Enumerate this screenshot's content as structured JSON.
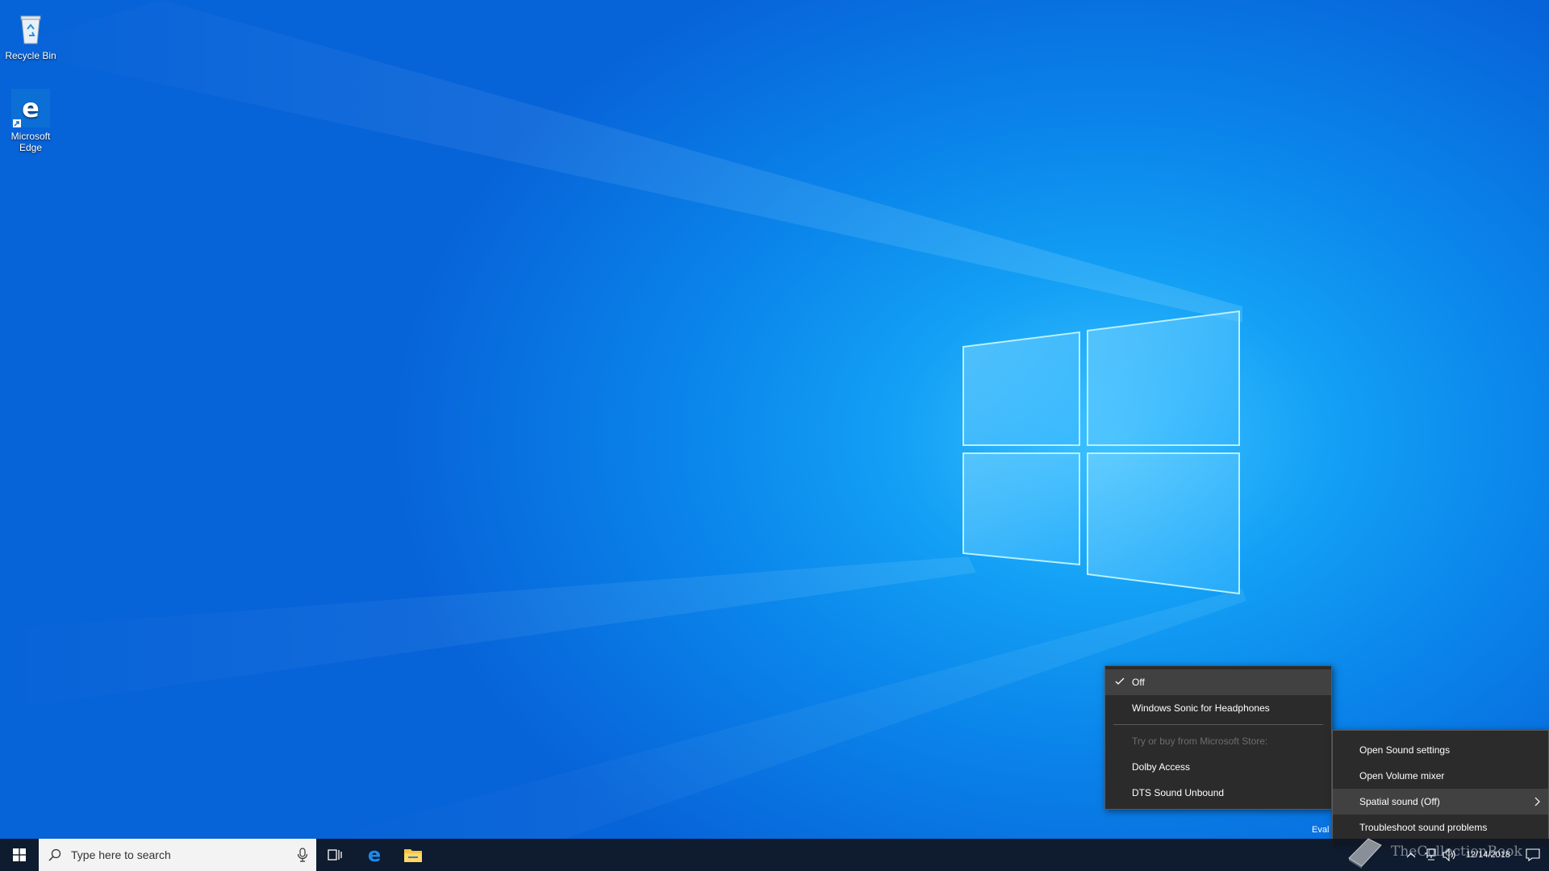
{
  "desktop": {
    "icons": [
      {
        "label": "Recycle Bin"
      },
      {
        "label": "Microsoft Edge"
      }
    ]
  },
  "spatial_menu": {
    "items": [
      {
        "label": "Off",
        "checked": true
      },
      {
        "label": "Windows Sonic for Headphones"
      }
    ],
    "store_header": "Try or buy from Microsoft Store:",
    "store_items": [
      {
        "label": "Dolby Access"
      },
      {
        "label": "DTS Sound Unbound"
      }
    ]
  },
  "sound_menu": {
    "items": [
      {
        "label": "Open Sound settings"
      },
      {
        "label": "Open Volume mixer"
      },
      {
        "label": "Spatial sound (Off)"
      },
      {
        "label": "Troubleshoot sound problems"
      }
    ]
  },
  "taskbar": {
    "search_placeholder": "Type here to search",
    "clock_date": "12/14/2018"
  },
  "eval_text": "Eval",
  "watermark_text": "TheCollectionBook",
  "colors": {
    "menu_bg": "#2b2b2b",
    "menu_highlight": "#414141",
    "taskbar_bg": "#101828",
    "desktop_accent": "#0a84ea"
  }
}
